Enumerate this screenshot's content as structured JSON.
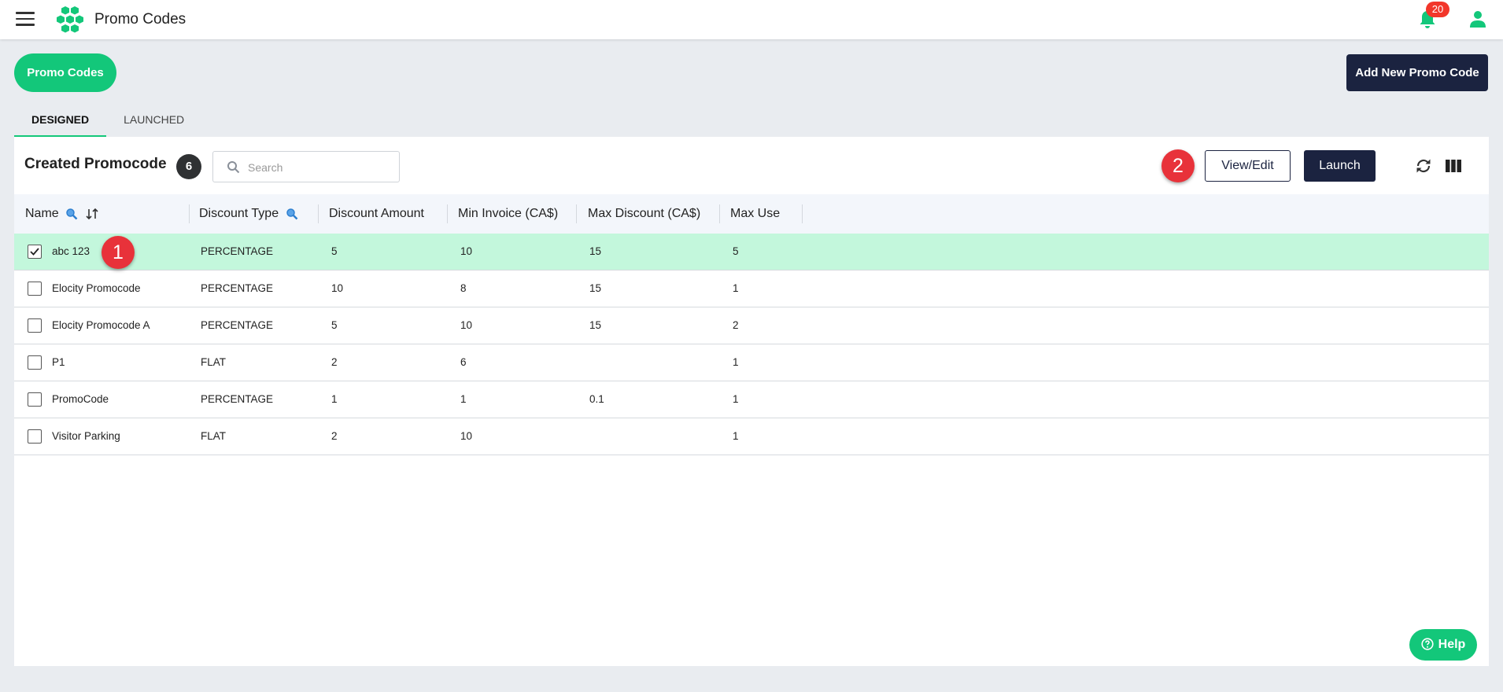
{
  "header": {
    "title": "Promo Codes",
    "notification_count": "20",
    "icons": [
      "hamburger-menu-icon",
      "hexagon-logo-icon",
      "bell-icon",
      "user-icon"
    ],
    "brand_color": "#13c77a"
  },
  "page": {
    "promo_button": "Promo Codes",
    "add_button": "Add New Promo Code"
  },
  "tabs": [
    {
      "label": "DESIGNED",
      "active": true
    },
    {
      "label": "LAUNCHED",
      "active": false
    }
  ],
  "table_card": {
    "title": "Created Promocode",
    "count": "6",
    "search_placeholder": "Search",
    "view_edit_label": "View/Edit",
    "launch_label": "Launch",
    "markers": [
      "1",
      "2"
    ],
    "icons": [
      "search-icon",
      "refresh-icon",
      "columns-icon"
    ]
  },
  "table": {
    "columns": [
      "Name",
      "Discount Type",
      "Discount Amount",
      "Min Invoice (CA$)",
      "Max Discount (CA$)",
      "Max Use"
    ],
    "rows": [
      {
        "checked": true,
        "name": "abc 123",
        "type": "PERCENTAGE",
        "amount": "5",
        "min": "10",
        "max": "15",
        "use": "5"
      },
      {
        "checked": false,
        "name": "Elocity Promocode",
        "type": "PERCENTAGE",
        "amount": "10",
        "min": "8",
        "max": "15",
        "use": "1"
      },
      {
        "checked": false,
        "name": "Elocity Promocode A",
        "type": "PERCENTAGE",
        "amount": "5",
        "min": "10",
        "max": "15",
        "use": "2"
      },
      {
        "checked": false,
        "name": "P1",
        "type": "FLAT",
        "amount": "2",
        "min": "6",
        "max": "",
        "use": "1"
      },
      {
        "checked": false,
        "name": "PromoCode",
        "type": "PERCENTAGE",
        "amount": "1",
        "min": "1",
        "max": "0.1",
        "use": "1"
      },
      {
        "checked": false,
        "name": "Visitor Parking",
        "type": "FLAT",
        "amount": "2",
        "min": "10",
        "max": "",
        "use": "1"
      }
    ]
  },
  "help": {
    "label": "Help"
  }
}
